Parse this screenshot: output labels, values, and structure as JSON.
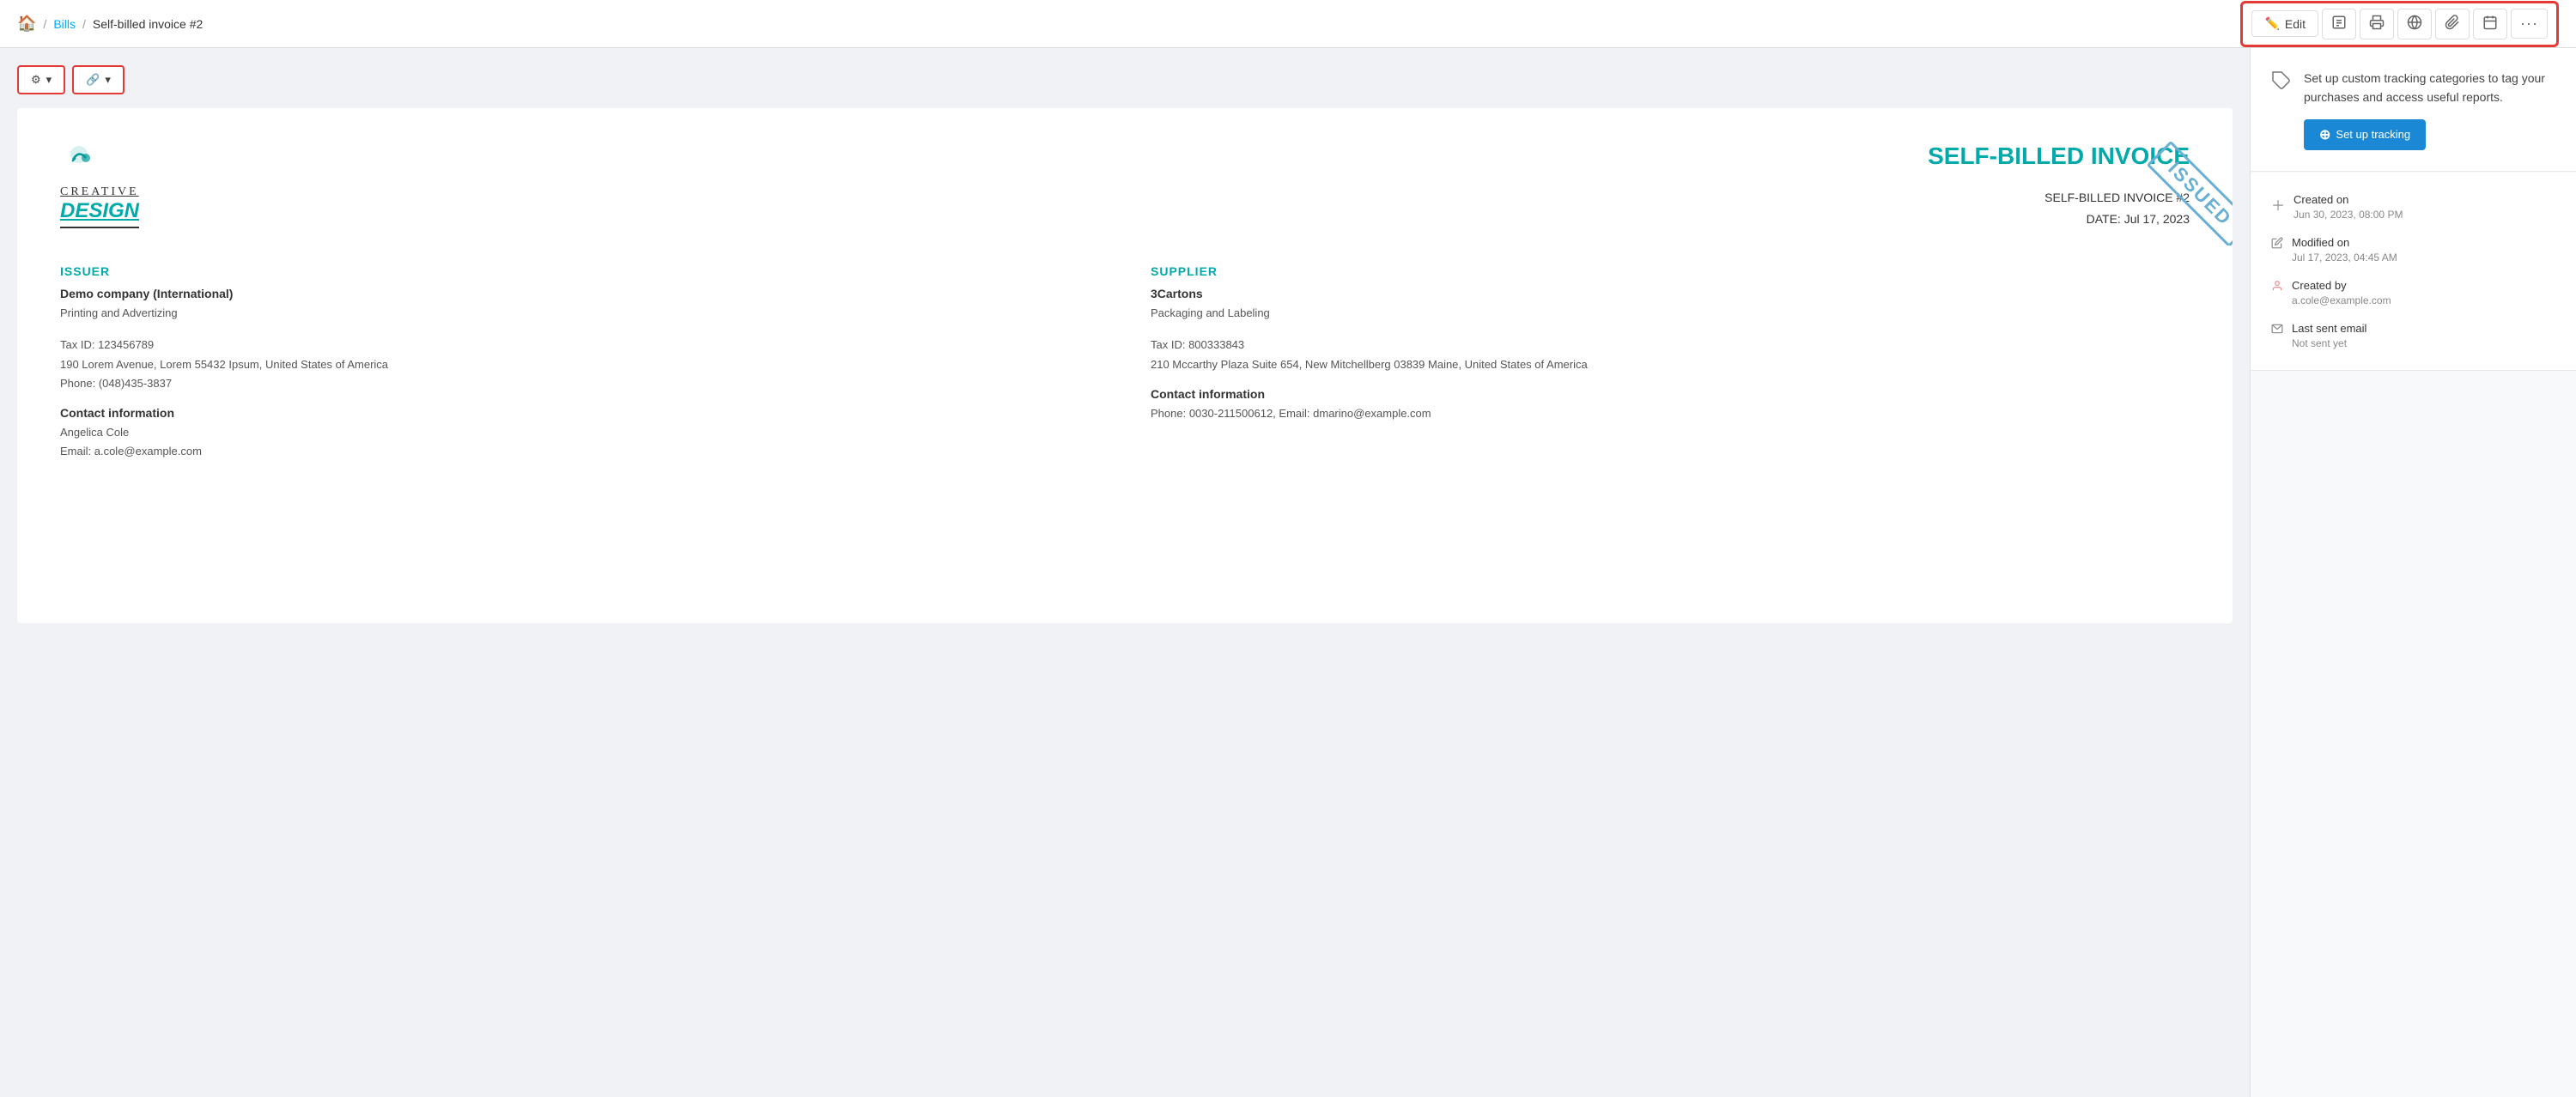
{
  "breadcrumb": {
    "home_icon": "🏠",
    "sep": "/",
    "link": "Bills",
    "current": "Self-billed invoice #2"
  },
  "toolbar": {
    "edit_label": "Edit",
    "edit_icon": "✏️",
    "pdf_icon": "📄",
    "print_icon": "🖨️",
    "send_icon": "📧",
    "attach_icon": "📎",
    "calendar_icon": "📅",
    "more_icon": "···"
  },
  "action_buttons": {
    "gear_label": "⚙",
    "gear_dropdown": "▾",
    "link_label": "🔗",
    "link_dropdown": "▾"
  },
  "invoice": {
    "stamp": "ISSUED",
    "main_title": "SELF-BILLED INVOICE",
    "invoice_number_label": "SELF-BILLED INVOICE #2",
    "date_label": "DATE: Jul 17, 2023",
    "issuer": {
      "section_label": "ISSUER",
      "name": "Demo company (International)",
      "type": "Printing and Advertizing",
      "tax_id": "Tax ID: 123456789",
      "address": "190 Lorem Avenue, Lorem 55432 Ipsum, United States of America",
      "phone": "Phone: (048)435-3837",
      "contact_label": "Contact information",
      "contact_name": "Angelica Cole",
      "contact_email": "Email: a.cole@example.com"
    },
    "supplier": {
      "section_label": "SUPPLIER",
      "name": "3Cartons",
      "type": "Packaging and Labeling",
      "tax_id": "Tax ID: 800333843",
      "address": "210 Mccarthy Plaza Suite 654, New Mitchellberg 03839 Maine, United States of America",
      "phone": "",
      "contact_label": "Contact information",
      "contact_phone": "Phone: 0030-211500612",
      "contact_email": "Email: dmarino@example.com"
    }
  },
  "sidebar": {
    "tracking": {
      "description": "Set up custom tracking categories to tag your purchases and access useful reports.",
      "button_label": "Set up tracking"
    },
    "info": {
      "created_label": "Created on",
      "created_value": "Jun 30, 2023, 08:00 PM",
      "modified_label": "Modified on",
      "modified_value": "Jul 17, 2023, 04:45 AM",
      "created_by_label": "Created by",
      "created_by_value": "a.cole@example.com",
      "last_sent_label": "Last sent email",
      "last_sent_value": "Not sent yet"
    }
  }
}
